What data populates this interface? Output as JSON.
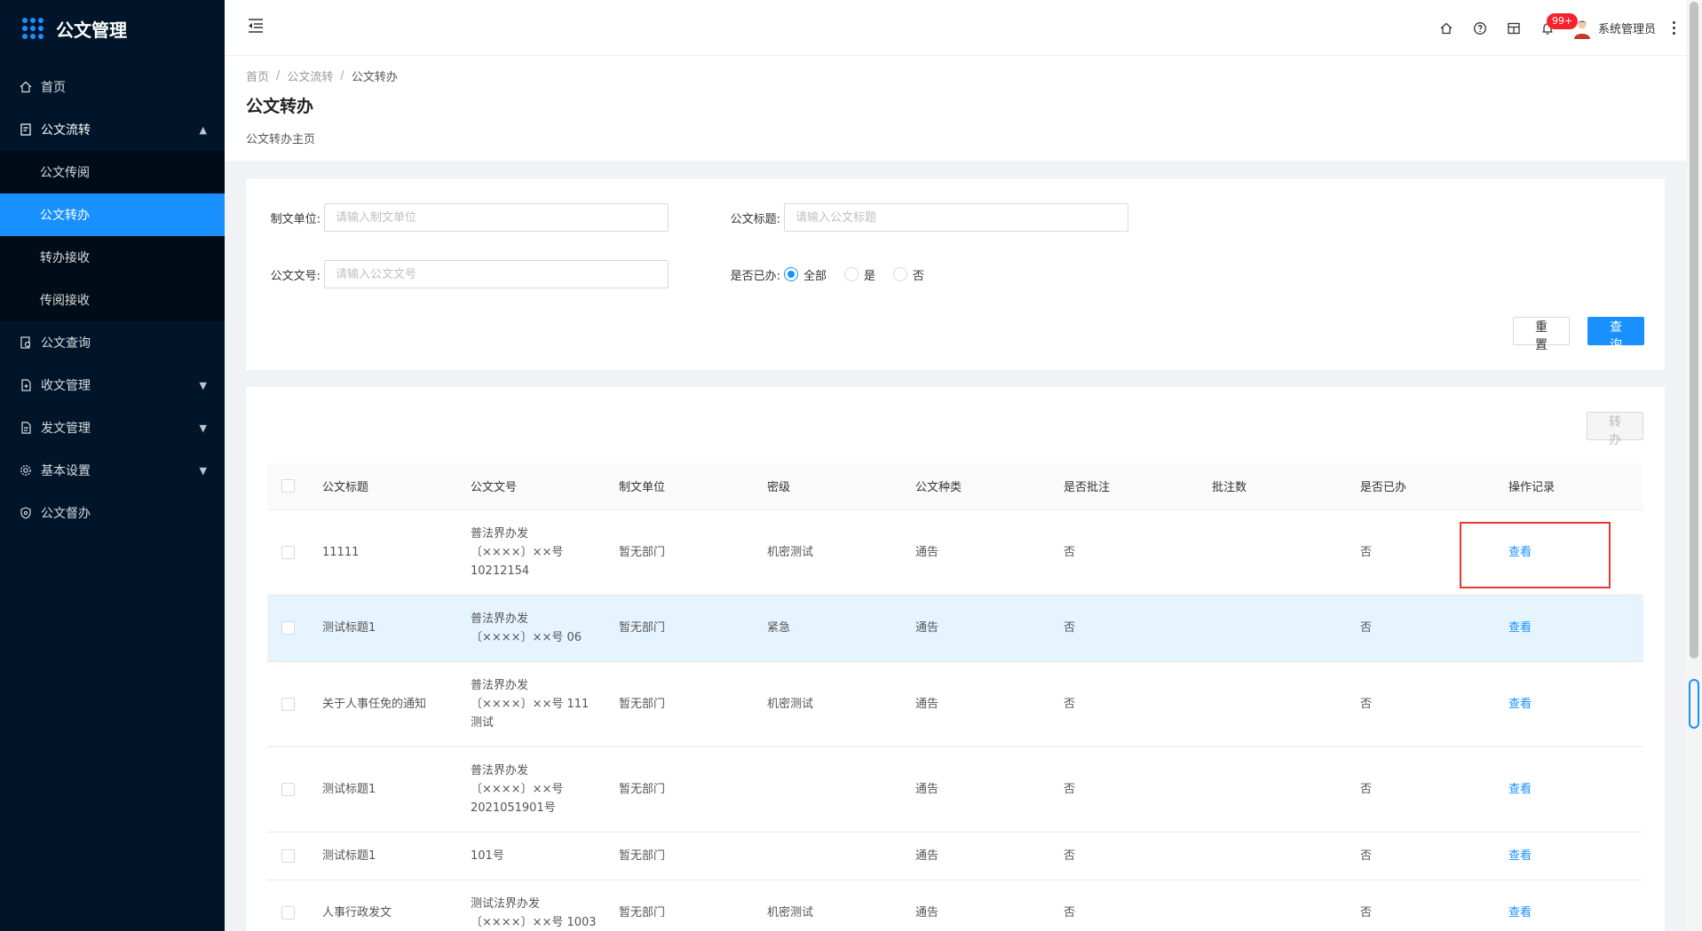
{
  "app": {
    "title": "公文管理"
  },
  "sidebar": {
    "items": [
      {
        "label": "首页",
        "icon": "home-icon"
      },
      {
        "label": "公文流转",
        "icon": "document-icon",
        "expanded": true,
        "children": [
          {
            "label": "公文传阅"
          },
          {
            "label": "公文转办",
            "active": true
          },
          {
            "label": "转办接收"
          },
          {
            "label": "传阅接收"
          }
        ]
      },
      {
        "label": "公文查询",
        "icon": "search-doc-icon"
      },
      {
        "label": "收文管理",
        "icon": "inbox-icon",
        "collapsible": true
      },
      {
        "label": "发文管理",
        "icon": "send-doc-icon",
        "collapsible": true
      },
      {
        "label": "基本设置",
        "icon": "gear-icon",
        "collapsible": true
      },
      {
        "label": "公文督办",
        "icon": "shield-icon"
      }
    ]
  },
  "header": {
    "badge": "99+",
    "user_name": "系统管理员"
  },
  "breadcrumb": [
    "首页",
    "公文流转",
    "公文转办"
  ],
  "page": {
    "title": "公文转办",
    "subtitle": "公文转办主页"
  },
  "search": {
    "unit_label": "制文单位:",
    "unit_placeholder": "请输入制文单位",
    "title_label": "公文标题:",
    "title_placeholder": "请输入公文标题",
    "number_label": "公文文号:",
    "number_placeholder": "请输入公文文号",
    "done_label": "是否已办:",
    "done_options": [
      "全部",
      "是",
      "否"
    ],
    "done_selected": "全部",
    "reset_label": "重 置",
    "query_label": "查 询"
  },
  "table": {
    "transfer_label": "转 办",
    "columns": [
      "公文标题",
      "公文文号",
      "制文单位",
      "密级",
      "公文种类",
      "是否批注",
      "批注数",
      "是否已办",
      "操作记录"
    ],
    "rows": [
      {
        "title": "11111",
        "number": [
          "普法界办发",
          "〔××××〕××号",
          "10212154"
        ],
        "unit": "暂无部门",
        "secret": "机密测试",
        "kind": "通告",
        "annotated": "否",
        "count": "",
        "done": "否",
        "action": "查看"
      },
      {
        "title": "测试标题1",
        "number": [
          "普法界办发",
          "〔××××〕××号 06"
        ],
        "unit": "暂无部门",
        "secret": "紧急",
        "kind": "通告",
        "annotated": "否",
        "count": "",
        "done": "否",
        "action": "查看"
      },
      {
        "title": "关于人事任免的通知",
        "number": [
          "普法界办发",
          "〔××××〕××号 111",
          "测试"
        ],
        "unit": "暂无部门",
        "secret": "机密测试",
        "kind": "通告",
        "annotated": "否",
        "count": "",
        "done": "否",
        "action": "查看"
      },
      {
        "title": "测试标题1",
        "number": [
          "普法界办发",
          "〔××××〕××号",
          "2021051901号"
        ],
        "unit": "暂无部门",
        "secret": "",
        "kind": "通告",
        "annotated": "否",
        "count": "",
        "done": "否",
        "action": "查看"
      },
      {
        "title": "测试标题1",
        "number": [
          "101号"
        ],
        "unit": "暂无部门",
        "secret": "",
        "kind": "通告",
        "annotated": "否",
        "count": "",
        "done": "否",
        "action": "查看"
      },
      {
        "title": "人事行政发文",
        "number": [
          "测试法界办发",
          "〔××××〕××号 1003"
        ],
        "unit": "暂无部门",
        "secret": "机密测试",
        "kind": "通告",
        "annotated": "否",
        "count": "",
        "done": "否",
        "action": "查看"
      }
    ]
  },
  "colors": {
    "primary": "#1890ff",
    "sidebar_bg": "#001529",
    "highlight_box": "#e53935"
  }
}
